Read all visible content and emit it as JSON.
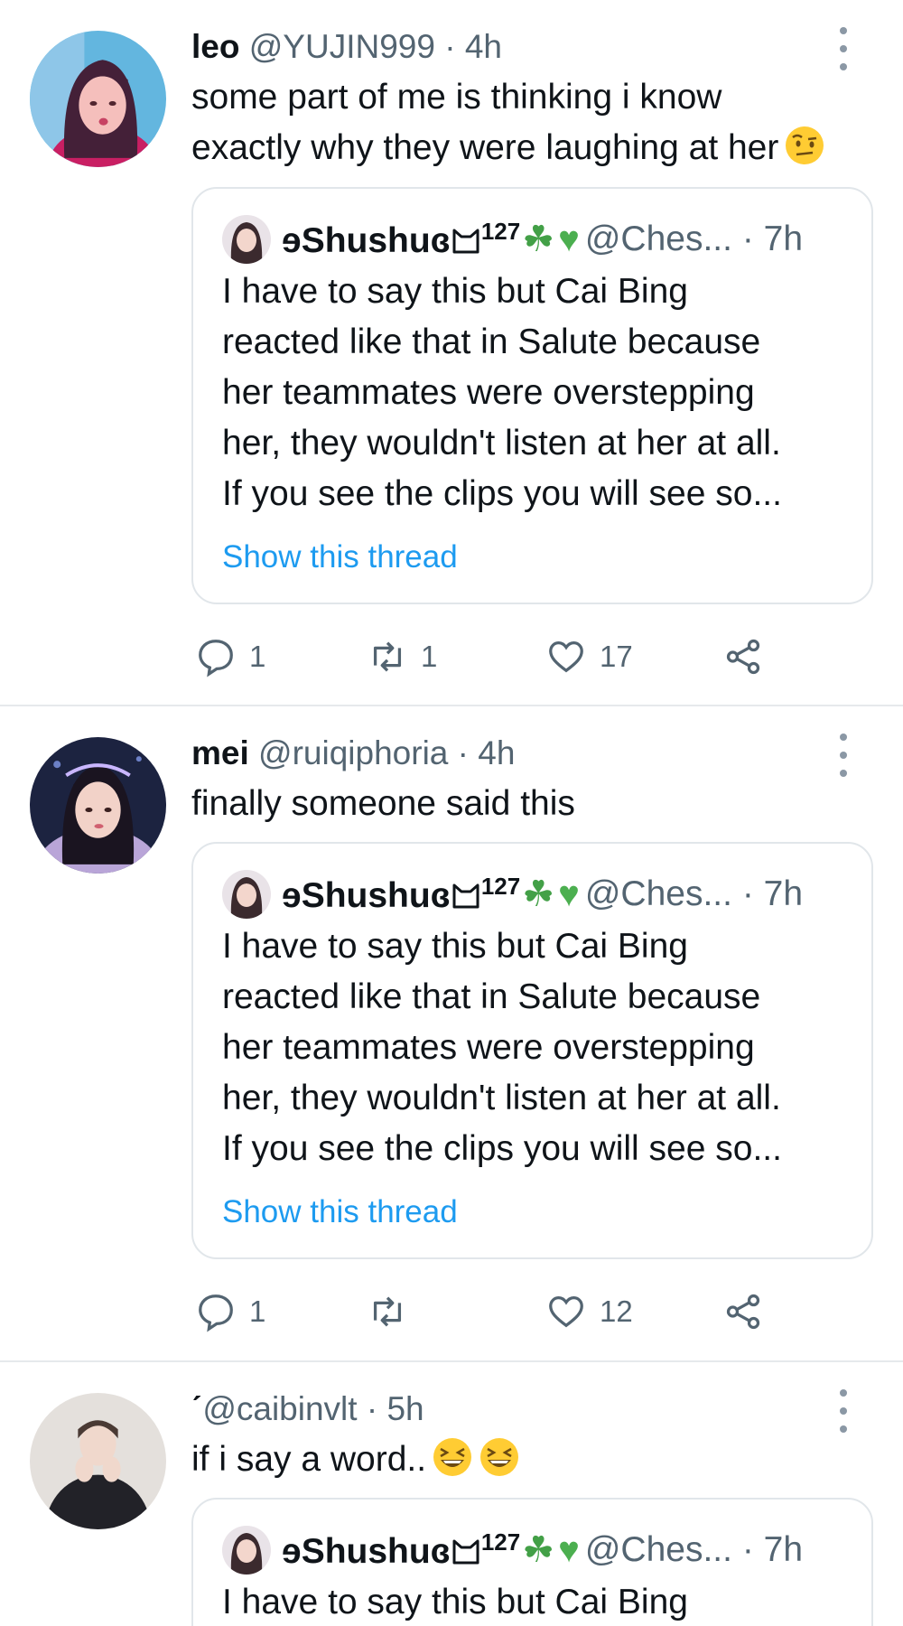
{
  "tweets": [
    {
      "name": "leo",
      "handle": "@YUJIN999",
      "time": "· 4h",
      "text": [
        "some part of me is thinking i know",
        "exactly why they were laughing at her"
      ],
      "emoji": [
        "face-with-raised-eyebrow-emoji"
      ],
      "quote": {
        "name": "ɘShushuɞ",
        "sup": "127",
        "handle": "@Ches...",
        "time": "· 7h",
        "lines": [
          "I have to say this but Cai Bing",
          "reacted like that in Salute because",
          "her teammates were overstepping",
          "her, they wouldn't listen at her at all.",
          "If you see the clips you will see so..."
        ],
        "show_thread": "Show this thread"
      },
      "actions": {
        "replies": "1",
        "retweets": "1",
        "likes": "17"
      }
    },
    {
      "name": "mei",
      "handle": "@ruiqiphoria",
      "time": "· 4h",
      "text": [
        "finally someone said this"
      ],
      "quote": {
        "name": "ɘShushuɞ",
        "sup": "127",
        "handle": "@Ches...",
        "time": "· 7h",
        "lines": [
          "I have to say this but Cai Bing",
          "reacted like that in Salute because",
          "her teammates were overstepping",
          "her, they wouldn't listen at her at all.",
          "If you see the clips you will see so..."
        ],
        "show_thread": "Show this thread"
      },
      "actions": {
        "replies": "1",
        "retweets": "",
        "likes": "12"
      }
    },
    {
      "name": "ˊ",
      "handle": "@caibinvlt",
      "time": "· 5h",
      "text": [
        "if i say a word.."
      ],
      "emoji": [
        "grinning-squinting-face-emoji",
        "grinning-squinting-face-emoji"
      ],
      "quote": {
        "name": "ɘShushuɞ",
        "sup": "127",
        "handle": "@Ches...",
        "time": "· 7h",
        "lines": [
          "I have to say this but Cai Bing"
        ]
      }
    }
  ],
  "colors": {
    "link": "#1d9bf0",
    "muted": "#536471",
    "divider": "#e6e9ec"
  },
  "icons": [
    "reply-icon",
    "retweet-icon",
    "like-icon",
    "share-icon",
    "more-options-icon"
  ]
}
